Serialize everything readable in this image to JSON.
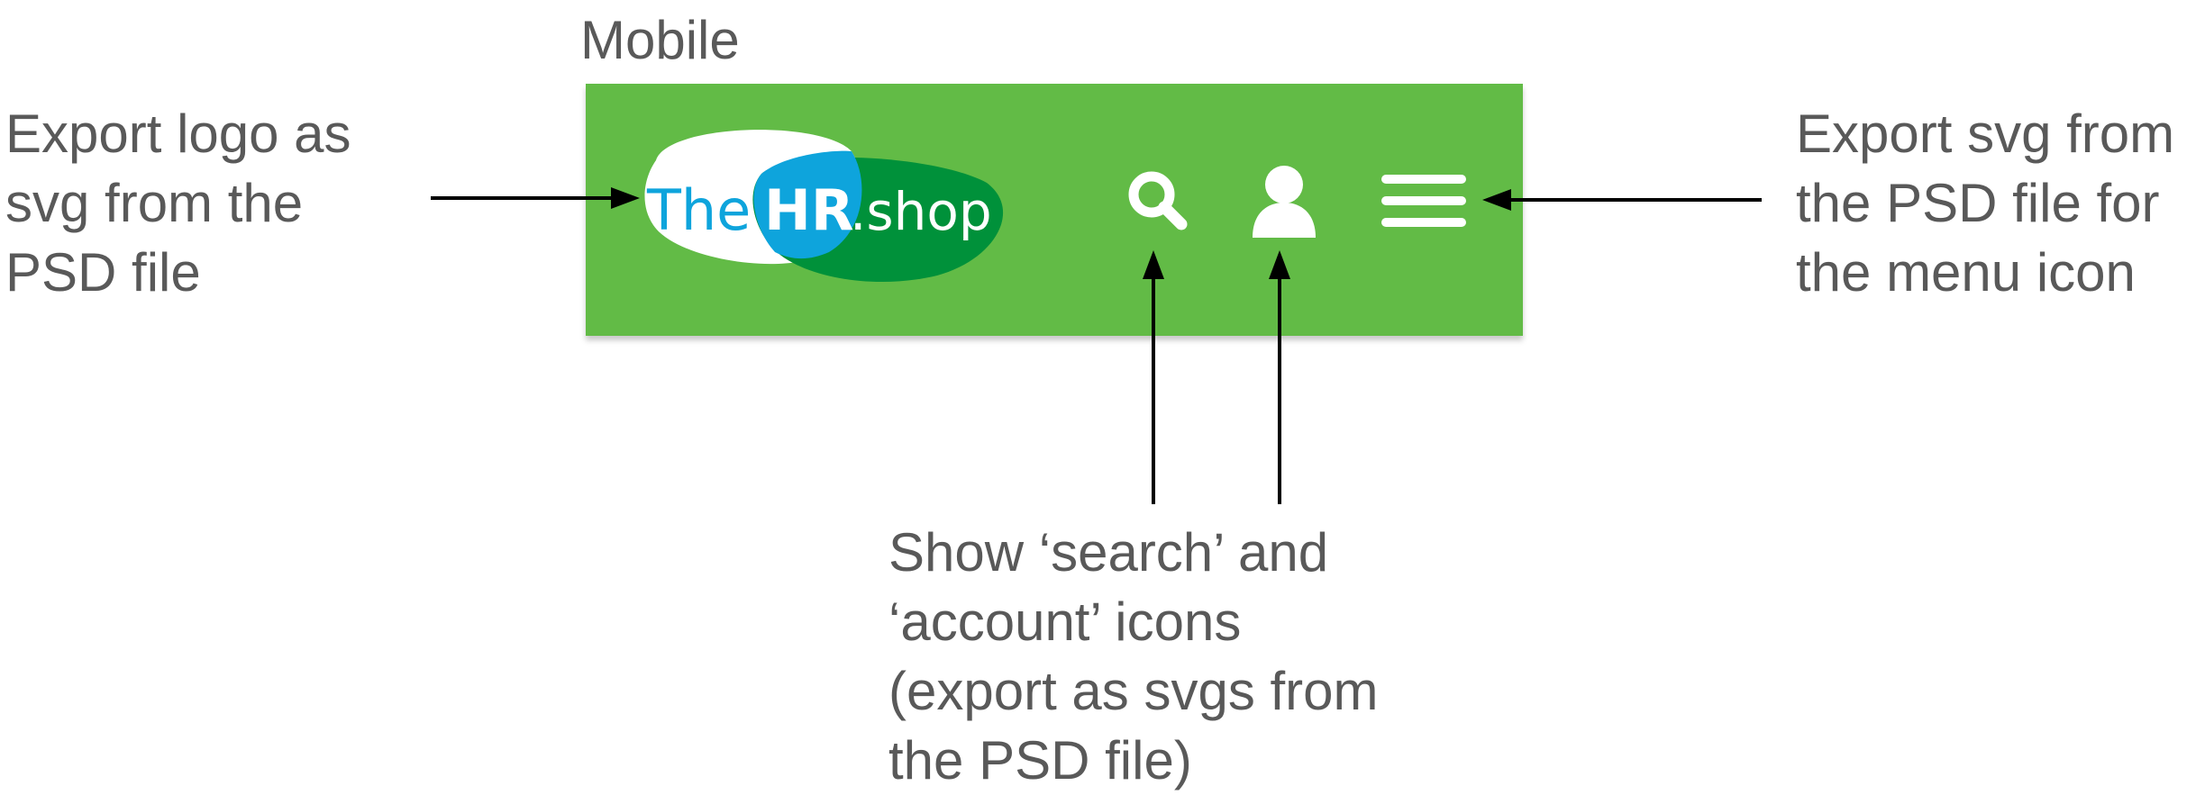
{
  "section_title": "Mobile",
  "notes": {
    "left": "Export logo as\nsvg from the\nPSD file",
    "right": "Export svg from\nthe PSD file for\nthe menu icon",
    "bottom": "Show ‘search’ and\n‘account’ icons\n(export as svgs from\nthe PSD file)"
  },
  "header": {
    "logo": {
      "text_the": "The",
      "text_hr": "HR",
      "text_shop": ".shop"
    },
    "icons": [
      "search-icon",
      "account-icon",
      "hamburger-menu-icon"
    ]
  },
  "colors": {
    "header_bg": "#62bb46",
    "logo_blue": "#0ea4dc",
    "logo_dark_green": "#00913a",
    "icon_white": "#ffffff"
  }
}
